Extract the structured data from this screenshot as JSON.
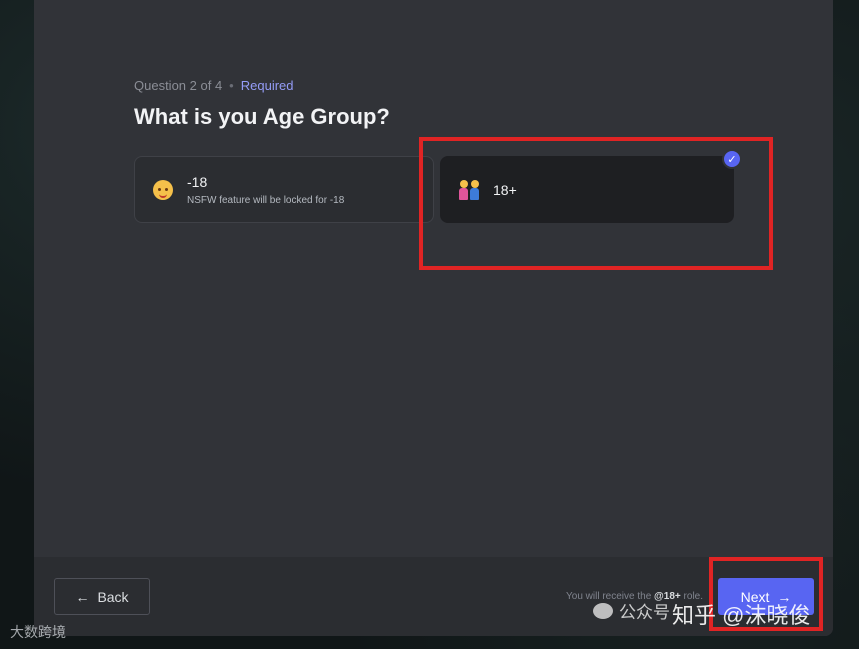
{
  "progress": {
    "question_counter": "Question 2 of 4",
    "separator": "•",
    "required_label": "Required"
  },
  "question": {
    "title": "What is you Age Group?"
  },
  "options": [
    {
      "title": "-18",
      "description": "NSFW feature will be locked for -18",
      "icon": "baby-emoji-icon",
      "selected": false
    },
    {
      "title": "18+",
      "description": "",
      "icon": "couple-emoji-icon",
      "selected": true
    }
  ],
  "footer": {
    "back_label": "Back",
    "back_icon": "arrow-left-icon",
    "note_prefix": "You will receive the",
    "note_role": "@18+",
    "note_suffix": "role.",
    "next_label": "Next",
    "next_icon": "arrow-right-icon"
  },
  "watermarks": {
    "left": "大数跨境",
    "wechat": "公众号",
    "zhihu": "知乎 @沫晓俊"
  },
  "colors": {
    "modal_bg": "#313338",
    "accent": "#5865f2",
    "required": "#949cf7",
    "highlight": "#e02424"
  }
}
